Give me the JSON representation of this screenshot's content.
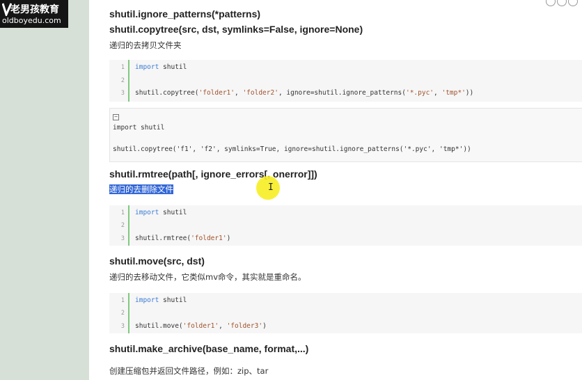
{
  "logo": {
    "text_cn": "老男孩教育",
    "url": "oldboyedu.com"
  },
  "sections": {
    "ignore_patterns": {
      "heading": "shutil.ignore_patterns(*patterns)"
    },
    "copytree": {
      "heading": "shutil.copytree(src, dst, symlinks=False, ignore=None)",
      "desc": "递归的去拷贝文件夹",
      "code": {
        "line_numbers": [
          "1",
          "2",
          "3"
        ],
        "l1_kw": "import",
        "l1_rest": " shutil",
        "l3_a": "shutil.copytree(",
        "l3_s1": "'folder1'",
        "l3_b": ", ",
        "l3_s2": "'folder2'",
        "l3_c": ", ignore=shutil.ignore_patterns(",
        "l3_s3": "'*.pyc'",
        "l3_d": ", ",
        "l3_s4": "'tmp*'",
        "l3_e": "))"
      },
      "plain_code": {
        "toggle": "−",
        "line1": "import shutil",
        "line2": "shutil.copytree('f1', 'f2', symlinks=True, ignore=shutil.ignore_patterns('*.pyc', 'tmp*'))"
      }
    },
    "rmtree": {
      "heading": "shutil.rmtree(path[, ignore_errors[, onerror]])",
      "desc": "递归的去删除文件",
      "code": {
        "line_numbers": [
          "1",
          "2",
          "3"
        ],
        "l1_kw": "import",
        "l1_rest": " shutil",
        "l3_a": "shutil.rmtree(",
        "l3_s1": "'folder1'",
        "l3_b": ")"
      }
    },
    "move": {
      "heading": "shutil.move(src, dst)",
      "desc": "递归的去移动文件，它类似mv命令，其实就是重命名。",
      "code": {
        "line_numbers": [
          "1",
          "2",
          "3"
        ],
        "l1_kw": "import",
        "l1_rest": " shutil",
        "l3_a": "shutil.move(",
        "l3_s1": "'folder1'",
        "l3_b": ", ",
        "l3_s2": "'folder3'",
        "l3_c": ")"
      }
    },
    "make_archive": {
      "heading": "shutil.make_archive(base_name, format,...)",
      "desc": "创建压缩包并返回文件路径，例如：zip、tar"
    }
  },
  "colors": {
    "sidebar": "#d7e0d6",
    "code_border": "#7fc97f",
    "keyword": "#3a7bd5",
    "string": "#a0522d",
    "selection": "#3367d6",
    "cursor_halo": "#f7ee22"
  },
  "cursor": "text-cursor"
}
